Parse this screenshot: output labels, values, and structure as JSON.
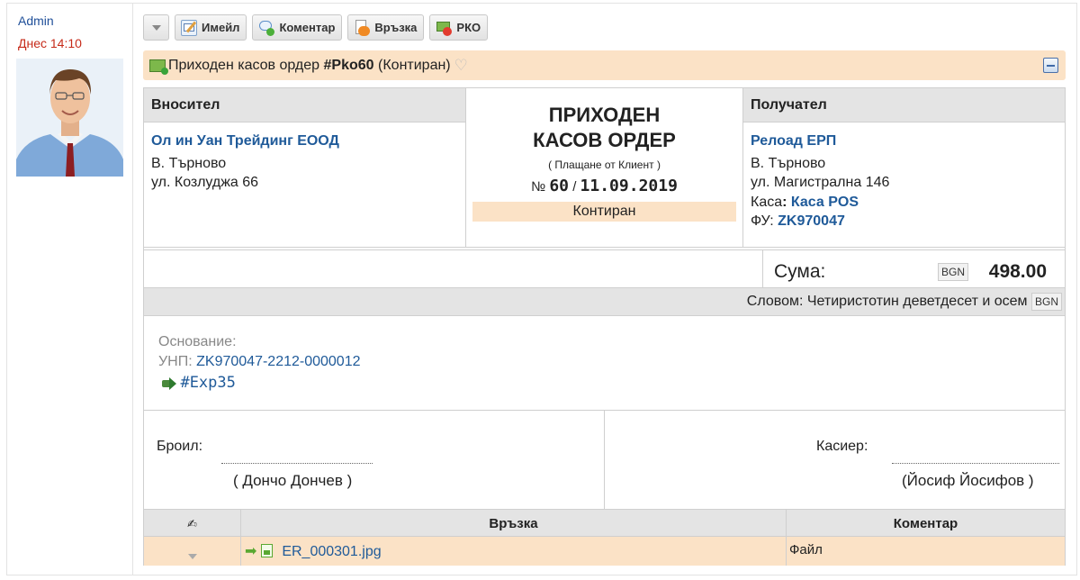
{
  "author": {
    "name": "Admin",
    "date": "Днес 14:10"
  },
  "toolbar": {
    "buttons": [
      {
        "label": "Имейл",
        "icon": "email-icon"
      },
      {
        "label": "Коментар",
        "icon": "comment-icon"
      },
      {
        "label": "Връзка",
        "icon": "link-icon"
      },
      {
        "label": "РКО",
        "icon": "cash-out-icon"
      }
    ]
  },
  "title": {
    "prefix": "Приходен касов ордер",
    "handle": "#Pko60",
    "state": "(Контиран)"
  },
  "payer": {
    "header": "Вносител",
    "name": "Ол ин Уан Трейдинг ЕООД",
    "city": "В. Търново",
    "address": "ул. Козлуджа 66"
  },
  "doc": {
    "title_line1": "ПРИХОДЕН",
    "title_line2": "КАСОВ ОРДЕР",
    "subtitle": "( Плащане от Клиент )",
    "number_prefix": "№",
    "number": "60",
    "date_sep": "/",
    "date": "11.09.2019",
    "status": "Контиран"
  },
  "receiver": {
    "header": "Получател",
    "name": "Релоад ЕРП",
    "city": "В. Търново",
    "address": "ул. Магистрална 146",
    "cash_label": "Каса",
    "cash_colon": ":",
    "cash_value": "Каса POS",
    "fu_label": "ФУ:",
    "fu_value": "ZK970047"
  },
  "amount": {
    "label": "Сума:",
    "currency": "BGN",
    "value": "498.00"
  },
  "words": {
    "text": "Словом: Четиристотин деветдесет и осем",
    "currency": "BGN"
  },
  "basis": {
    "label": "Основание:",
    "unp_label": "УНП:",
    "unp_value": "ZK970047-2212-0000012",
    "exp": "#Exp35"
  },
  "signatures": {
    "compiled_label": "Броил:",
    "compiled_name": "( Дончо Дончев )",
    "cashier_label": "Касиер:",
    "cashier_name": "(Йосиф Йосифов )"
  },
  "files": {
    "col_link": "Връзка",
    "col_comment": "Коментар",
    "rows": [
      {
        "file": "ER_000301.jpg",
        "comment": "Файл"
      }
    ]
  },
  "colors": {
    "accent_row": "#fbe2c6",
    "header_gray": "#e4e4e4",
    "link": "#1f5a99",
    "date_red": "#c62b1a"
  }
}
